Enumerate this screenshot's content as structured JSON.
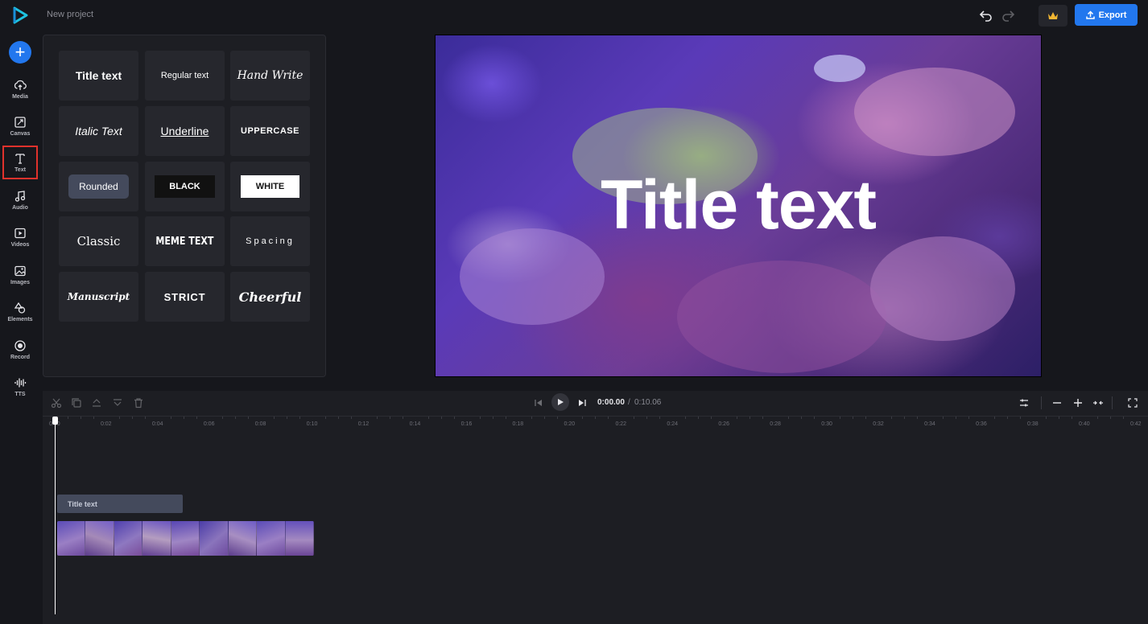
{
  "header": {
    "project_title": "New project",
    "export_label": "Export",
    "colors": {
      "accent": "#2277ee",
      "logo": "#1ec3e0",
      "crown": "#f2b632"
    }
  },
  "rail": {
    "items": [
      {
        "label": "Media",
        "icon": "cloud-upload-icon"
      },
      {
        "label": "Canvas",
        "icon": "canvas-resize-icon"
      },
      {
        "label": "Text",
        "icon": "text-icon",
        "active": true
      },
      {
        "label": "Audio",
        "icon": "music-note-icon"
      },
      {
        "label": "Videos",
        "icon": "video-play-icon"
      },
      {
        "label": "Images",
        "icon": "image-icon"
      },
      {
        "label": "Elements",
        "icon": "shapes-icon"
      },
      {
        "label": "Record",
        "icon": "record-icon"
      },
      {
        "label": "TTS",
        "icon": "waveform-icon"
      }
    ]
  },
  "text_styles": [
    {
      "label": "Title text"
    },
    {
      "label": "Regular text"
    },
    {
      "label": "Hand Write"
    },
    {
      "label": "Italic Text"
    },
    {
      "label": "Underline"
    },
    {
      "label": "UPPERCASE"
    },
    {
      "label": "Rounded"
    },
    {
      "label": "BLACK"
    },
    {
      "label": "WHITE"
    },
    {
      "label": "Classic"
    },
    {
      "label": "MEME TEXT"
    },
    {
      "label": "Spacing"
    },
    {
      "label": "Manuscript"
    },
    {
      "label": "STRICT"
    },
    {
      "label": "Cheerful"
    }
  ],
  "preview": {
    "overlay_text": "Title text"
  },
  "timeline": {
    "current_time": "0:00.00",
    "separator": "/",
    "total_time": "0:10.06",
    "ruler_ticks": [
      "0:00",
      "0:02",
      "0:04",
      "0:06",
      "0:08",
      "0:10",
      "0:12",
      "0:14",
      "0:16",
      "0:18",
      "0:20",
      "0:22",
      "0:24",
      "0:26",
      "0:28",
      "0:30",
      "0:32",
      "0:34",
      "0:36",
      "0:38",
      "0:40",
      "0:42"
    ],
    "text_clip_label": "Title text"
  }
}
